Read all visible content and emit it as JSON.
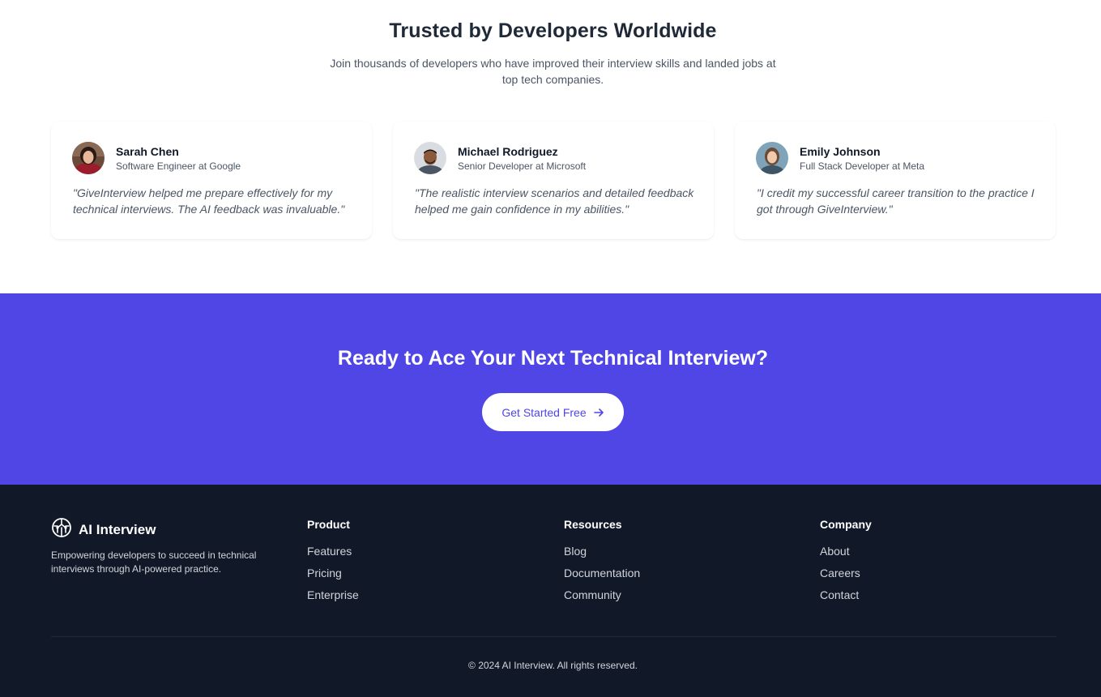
{
  "testimonials": {
    "title": "Trusted by Developers Worldwide",
    "subtitle": "Join thousands of developers who have improved their interview skills and landed jobs at top tech companies.",
    "items": [
      {
        "name": "Sarah Chen",
        "role": "Software Engineer at Google",
        "quote": "\"GiveInterview helped me prepare effectively for my technical interviews. The AI feedback was invaluable.\""
      },
      {
        "name": "Michael Rodriguez",
        "role": "Senior Developer at Microsoft",
        "quote": "\"The realistic interview scenarios and detailed feedback helped me gain confidence in my abilities.\""
      },
      {
        "name": "Emily Johnson",
        "role": "Full Stack Developer at Meta",
        "quote": "\"I credit my successful career transition to the practice I got through GiveInterview.\""
      }
    ]
  },
  "cta": {
    "title": "Ready to Ace Your Next Technical Interview?",
    "button_label": "Get Started Free",
    "button_icon": "arrow-right-icon"
  },
  "footer": {
    "brand_name": "AI Interview",
    "brand_icon": "brain-icon",
    "description": "Empowering developers to succeed in technical interviews through AI-powered practice.",
    "columns": [
      {
        "heading": "Product",
        "links": [
          "Features",
          "Pricing",
          "Enterprise"
        ]
      },
      {
        "heading": "Resources",
        "links": [
          "Blog",
          "Documentation",
          "Community"
        ]
      },
      {
        "heading": "Company",
        "links": [
          "About",
          "Careers",
          "Contact"
        ]
      }
    ],
    "copyright": "© 2024 AI Interview. All rights reserved."
  },
  "colors": {
    "accent": "#4f46e5",
    "footer_bg": "#111827",
    "text_dark": "#111827",
    "text_muted": "#4b5563"
  }
}
